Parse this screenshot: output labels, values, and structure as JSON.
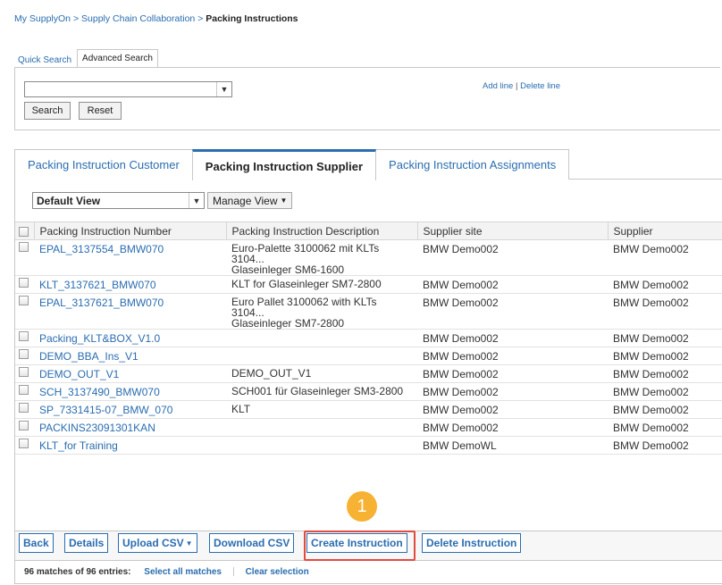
{
  "breadcrumb": {
    "items": [
      "My SupplyOn",
      "Supply Chain Collaboration"
    ],
    "separator": ">",
    "current": "Packing Instructions"
  },
  "search": {
    "tabs": [
      "Quick Search",
      "Advanced Search"
    ],
    "active_tab": "Advanced Search",
    "select_value": "",
    "add_line": "Add line",
    "delete_line": "Delete line",
    "search_button": "Search",
    "reset_button": "Reset"
  },
  "main_tabs": [
    {
      "label": "Packing Instruction Customer",
      "active": false
    },
    {
      "label": "Packing Instruction Supplier",
      "active": true
    },
    {
      "label": "Packing Instruction Assignments",
      "active": false
    }
  ],
  "view": {
    "selected": "Default View",
    "manage_label": "Manage View"
  },
  "table": {
    "columns": [
      "Packing Instruction Number",
      "Packing Instruction Description",
      "Supplier site",
      "Supplier"
    ],
    "rows": [
      {
        "number": "EPAL_3137554_BMW070",
        "desc1": "Euro-Palette 3100062 mit KLTs 3104...",
        "desc2": "Glaseinleger SM6-1600",
        "site": "BMW Demo002",
        "supplier": "BMW Demo002"
      },
      {
        "number": "KLT_3137621_BMW070",
        "desc1": "KLT for Glaseinleger SM7-2800",
        "desc2": "",
        "site": "BMW Demo002",
        "supplier": "BMW Demo002"
      },
      {
        "number": "EPAL_3137621_BMW070",
        "desc1": "Euro Pallet 3100062 with KLTs 3104...",
        "desc2": "Glaseinleger SM7-2800",
        "site": "BMW Demo002",
        "supplier": "BMW Demo002"
      },
      {
        "number": "Packing_KLT&BOX_V1.0",
        "desc1": "",
        "desc2": "",
        "site": "BMW Demo002",
        "supplier": "BMW Demo002"
      },
      {
        "number": "DEMO_BBA_Ins_V1",
        "desc1": "",
        "desc2": "",
        "site": "BMW Demo002",
        "supplier": "BMW Demo002"
      },
      {
        "number": "DEMO_OUT_V1",
        "desc1": "DEMO_OUT_V1",
        "desc2": "",
        "site": "BMW Demo002",
        "supplier": "BMW Demo002"
      },
      {
        "number": "SCH_3137490_BMW070",
        "desc1": "SCH001 für Glaseinleger SM3-2800",
        "desc2": "",
        "site": "BMW Demo002",
        "supplier": "BMW Demo002"
      },
      {
        "number": "SP_7331415-07_BMW_070",
        "desc1": "KLT",
        "desc2": "",
        "site": "BMW Demo002",
        "supplier": "BMW Demo002"
      },
      {
        "number": "PACKINS23091301KAN",
        "desc1": "",
        "desc2": "",
        "site": "BMW Demo002",
        "supplier": "BMW Demo002"
      },
      {
        "number": "KLT_for Training",
        "desc1": "",
        "desc2": "",
        "site": "BMW DemoWL",
        "supplier": "BMW Demo002"
      }
    ]
  },
  "actions": {
    "back": "Back",
    "details": "Details",
    "upload_csv": "Upload CSV",
    "download_csv": "Download CSV",
    "create_instruction": "Create Instruction",
    "delete_instruction": "Delete Instruction"
  },
  "marker_label": "1",
  "footer": {
    "count": "96 matches of 96 entries:",
    "select_all": "Select all matches",
    "clear_selection": "Clear selection"
  },
  "colors": {
    "link": "#2a6db0",
    "highlight": "#e24b40",
    "marker": "#f7b234"
  }
}
